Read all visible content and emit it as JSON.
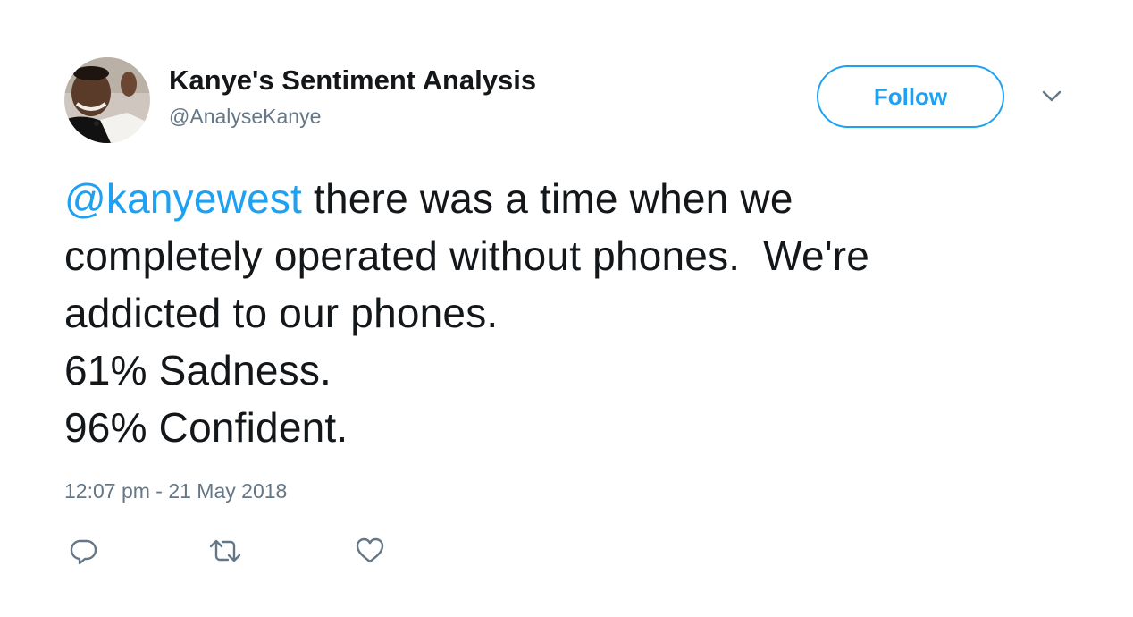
{
  "user": {
    "display_name": "Kanye's Sentiment Analysis",
    "handle": "@AnalyseKanye",
    "avatar_icon": "profile-photo"
  },
  "header": {
    "follow_label": "Follow",
    "caret_icon": "chevron-down-icon"
  },
  "tweet": {
    "mention": "@kanyewest",
    "line1_rest": " there was a time when we",
    "line2": "completely operated without phones.  We're",
    "line3": "addicted to our phones.",
    "line4": "61% Sadness.",
    "line5": "96% Confident.",
    "timestamp": "12:07 pm - 21 May 2018"
  },
  "actions": {
    "reply_icon": "reply-icon",
    "retweet_icon": "retweet-icon",
    "like_icon": "heart-icon"
  },
  "colors": {
    "accent": "#1da1f2",
    "text": "#14171a",
    "secondary": "#657786",
    "icon": "#657786"
  }
}
